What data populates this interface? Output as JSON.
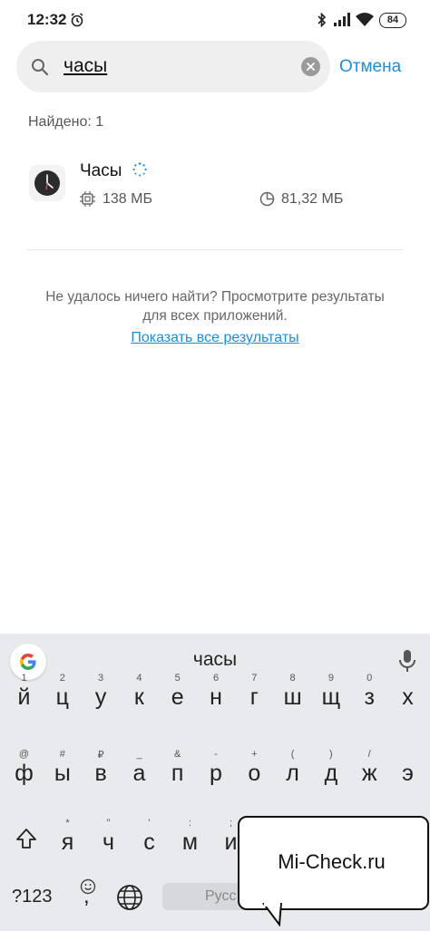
{
  "status_bar": {
    "time": "12:32",
    "battery": "84"
  },
  "search": {
    "query": "часы",
    "cancel_label": "Отмена"
  },
  "results": {
    "found_label": "Найдено: 1",
    "items": [
      {
        "name": "Часы",
        "storage": "138 МБ",
        "data_size": "81,32 МБ"
      }
    ]
  },
  "not_found": {
    "line1": "Не удалось ничего найти? Просмотрите результаты",
    "line2": "для всех приложений.",
    "show_all_label": "Показать все результаты"
  },
  "keyboard": {
    "suggestion": "часы",
    "row1": [
      {
        "key": "й",
        "hint": "1"
      },
      {
        "key": "ц",
        "hint": "2"
      },
      {
        "key": "у",
        "hint": "3"
      },
      {
        "key": "к",
        "hint": "4"
      },
      {
        "key": "е",
        "hint": "5"
      },
      {
        "key": "н",
        "hint": "6"
      },
      {
        "key": "г",
        "hint": "7"
      },
      {
        "key": "ш",
        "hint": "8"
      },
      {
        "key": "щ",
        "hint": "9"
      },
      {
        "key": "з",
        "hint": "0"
      },
      {
        "key": "х",
        "hint": ""
      }
    ],
    "row2": [
      {
        "key": "ф",
        "hint": "@"
      },
      {
        "key": "ы",
        "hint": "#"
      },
      {
        "key": "в",
        "hint": "₽"
      },
      {
        "key": "а",
        "hint": "_"
      },
      {
        "key": "п",
        "hint": "&"
      },
      {
        "key": "р",
        "hint": "-"
      },
      {
        "key": "о",
        "hint": "+"
      },
      {
        "key": "л",
        "hint": "("
      },
      {
        "key": "д",
        "hint": ")"
      },
      {
        "key": "ж",
        "hint": "/"
      },
      {
        "key": "э",
        "hint": ""
      }
    ],
    "row3": [
      {
        "key": "я",
        "hint": "*"
      },
      {
        "key": "ч",
        "hint": "\""
      },
      {
        "key": "с",
        "hint": "'"
      },
      {
        "key": "м",
        "hint": ":"
      },
      {
        "key": "и",
        "hint": ";"
      }
    ],
    "numbers_label": "?123",
    "comma": ",",
    "space_label": "Русс"
  },
  "watermark": {
    "text": "Mi-Check.ru"
  },
  "colors": {
    "accent": "#1a8fe0",
    "keyboard_bg": "#e8eaed"
  }
}
